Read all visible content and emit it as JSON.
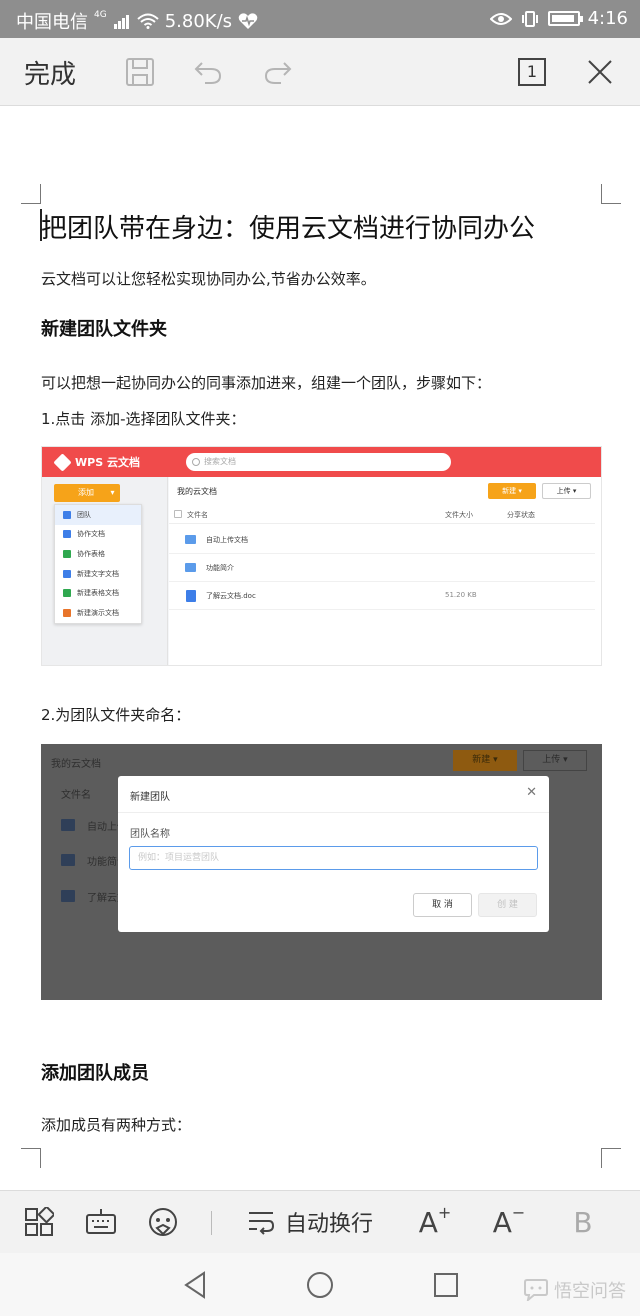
{
  "status_bar": {
    "carrier": "中国电信",
    "net_badge": "4G",
    "speed": "5.80K/s",
    "time": "4:16"
  },
  "toolbar": {
    "done_label": "完成",
    "page_count": "1"
  },
  "document": {
    "title": "把团队带在身边：使用云文档进行协同办公",
    "intro": "云文档可以让您轻松实现协同办公,节省办公效率。",
    "section1_heading": "新建团队文件夹",
    "section1_text": "可以把想一起协同办公的同事添加进来，组建一个团队，步骤如下：",
    "step1": "1.点击  添加-选择团队文件夹：",
    "step2": "2.为团队文件夹命名：",
    "section2_heading": "添加团队成员",
    "section2_text": "添加成员有两种方式："
  },
  "screenshot1": {
    "app_name": "WPS 云文档",
    "search_placeholder": "搜索文档",
    "add_button": "添加",
    "menu_items": [
      {
        "label": "团队",
        "color": "#3d7ee8"
      },
      {
        "label": "协作文档",
        "color": "#3d7ee8"
      },
      {
        "label": "协作表格",
        "color": "#2fa84f"
      },
      {
        "label": "新建文字文档",
        "color": "#3d7ee8"
      },
      {
        "label": "新建表格文档",
        "color": "#2fa84f"
      },
      {
        "label": "新建演示文档",
        "color": "#e8742a"
      }
    ],
    "breadcrumb": "我的云文档",
    "new_button": "新建",
    "upload_button": "上传",
    "col_name": "文件名",
    "col_size": "文件大小",
    "col_share": "分享状态",
    "rows": [
      {
        "name": "自动上传文档",
        "size": ""
      },
      {
        "name": "功能简介",
        "size": ""
      },
      {
        "name": "了解云文档.doc",
        "size": "51.20 KB"
      }
    ]
  },
  "screenshot2": {
    "breadcrumb": "我的云文档",
    "new_button": "新建",
    "upload_button": "上传",
    "col_name": "文件名",
    "row1": "自动上传",
    "row2": "功能简介",
    "row3": "了解云文",
    "dialog_title": "新建团队",
    "field_label": "团队名称",
    "field_placeholder": "例如：项目运营团队",
    "cancel_button": "取 消",
    "create_button": "创 建"
  },
  "format_bar": {
    "wrap_label": "自动换行"
  },
  "watermark": "悟空问答",
  "colors": {
    "status_bg": "#8e8e8e",
    "wps_red": "#f04b4b",
    "wps_orange": "#f6a319",
    "accent_blue": "#5b9bea"
  }
}
